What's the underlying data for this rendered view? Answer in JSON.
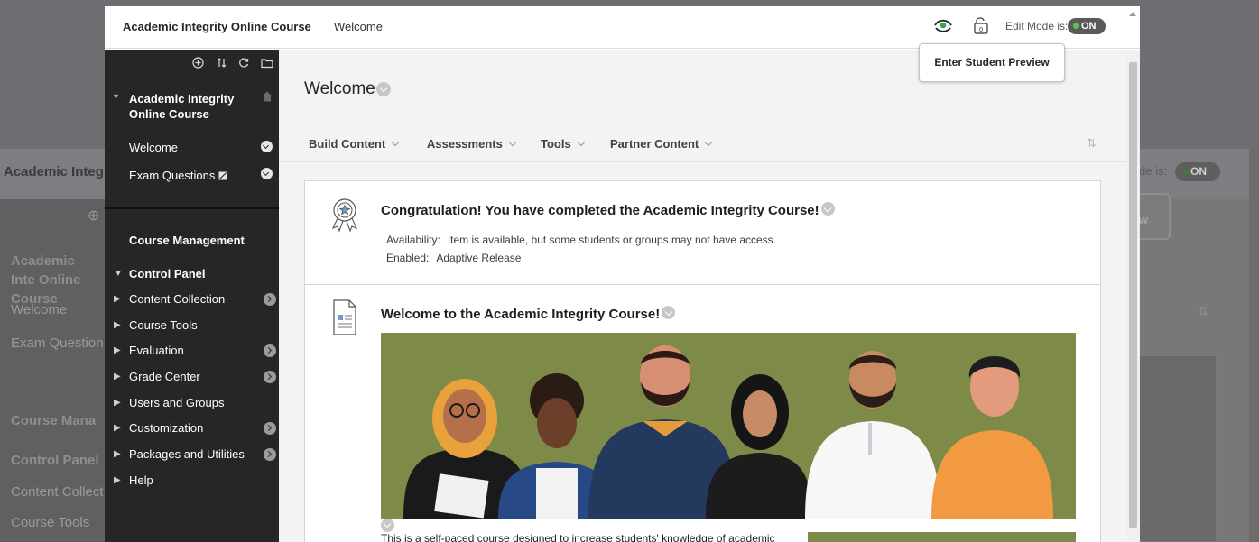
{
  "background": {
    "course_title": "Academic Integ",
    "edit_mode_label": "de is:",
    "toggle": "ON",
    "popup_fragment": "w",
    "sidebar": {
      "course_name": "Academic Inte Online Course",
      "items": [
        "Welcome",
        "Exam Question"
      ],
      "management": "Course Mana",
      "control_panel": "Control Panel",
      "panel_items": [
        "Content Collect",
        "Course Tools"
      ]
    }
  },
  "header": {
    "course_title": "Academic Integrity Online Course",
    "breadcrumb": "Welcome",
    "edit_mode_label": "Edit Mode is:",
    "edit_mode_value": "ON",
    "tooltip": "Enter Student Preview"
  },
  "sidebar": {
    "course_name": "Academic Integrity Online Course",
    "links": [
      {
        "label": "Welcome"
      },
      {
        "label": "Exam Questions"
      }
    ],
    "course_management": "Course Management",
    "control_panel": "Control Panel",
    "control_items": [
      {
        "label": "Content Collection",
        "arrow": true
      },
      {
        "label": "Course Tools",
        "arrow": false
      },
      {
        "label": "Evaluation",
        "arrow": true
      },
      {
        "label": "Grade Center",
        "arrow": true
      },
      {
        "label": "Users and Groups",
        "arrow": false
      },
      {
        "label": "Customization",
        "arrow": true
      },
      {
        "label": "Packages and Utilities",
        "arrow": true
      },
      {
        "label": "Help",
        "arrow": false
      }
    ]
  },
  "main": {
    "page_title": "Welcome",
    "menu": [
      "Build Content",
      "Assessments",
      "Tools",
      "Partner Content"
    ],
    "items": [
      {
        "title": "Congratulation! You have completed the Academic Integrity Course!",
        "availability_label": "Availability:",
        "availability_value": "Item is available, but some students or groups may not have access.",
        "enabled_label": "Enabled:",
        "enabled_value": "Adaptive Release",
        "icon": "award-icon"
      },
      {
        "title": "Welcome to the Academic Integrity Course!",
        "description": "This is a self-paced course designed to increase students' knowledge of academic",
        "icon": "document-icon"
      }
    ]
  },
  "colors": {
    "sidebar": "#262626",
    "banner": "#7e8a48",
    "toggle_on": "#57c45a"
  }
}
